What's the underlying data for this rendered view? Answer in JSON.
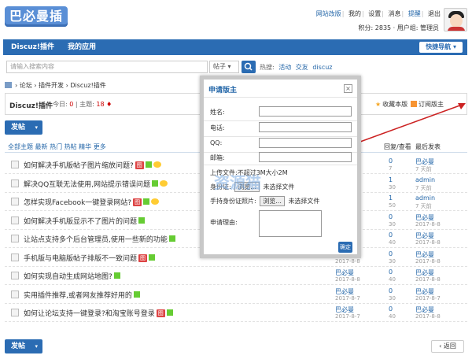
{
  "logo": {
    "text": "巴必曼插件"
  },
  "topbar": {
    "links": [
      "网站改版",
      "我的",
      "设置",
      "消息",
      "提醒",
      "退出"
    ],
    "userinfo": "积分: 2835 · 用户组: 管理员"
  },
  "nav": {
    "items": [
      "Discuz!插件",
      "我的应用"
    ],
    "quick": "快捷导航"
  },
  "search": {
    "placeholder": "请输入搜索内容",
    "type": "帖子",
    "hot_label": "热搜:",
    "hot": [
      "活动",
      "交友",
      "discuz"
    ]
  },
  "breadcrumb": [
    "论坛",
    "插件开发",
    "Discuz!插件"
  ],
  "forum": {
    "name": "Discuz!插件",
    "stats_label": "今日:",
    "today": "0",
    "topics_label": "主题:",
    "topics": "18",
    "fav": "收藏本版",
    "subscribe": "订阅版主"
  },
  "buttons": {
    "post": "发帖",
    "back": "返回"
  },
  "list": {
    "header_title": "全部主题  最新 热门 热帖 精华 更多",
    "header_author": "回复/查看",
    "header_last": "最后发表",
    "rows": [
      {
        "title": "如何解决手机版帖子图片缩放问题?",
        "badge": "图",
        "author": "巴必曼",
        "date": "2017-8-8",
        "cnt": "0",
        "cnt2": "7",
        "last": "巴必曼",
        "last2": "7 天前"
      },
      {
        "title": "解决QQ互联无法使用,网站提示错误问题",
        "badge": "",
        "author": "巴必曼",
        "date": "2017-8-8",
        "cnt": "1",
        "cnt2": "30",
        "last": "admin",
        "last2": "7 天前"
      },
      {
        "title": "怎样实现Facebook一键登录网站?",
        "badge": "图",
        "author": "巴必曼",
        "date": "2017-8-8",
        "cnt": "1",
        "cnt2": "50",
        "last": "admin",
        "last2": "7 天前"
      },
      {
        "title": "如何解决手机版显示不了图片的问题",
        "badge": "",
        "author": "巴必曼",
        "date": "2017-8-8",
        "cnt": "0",
        "cnt2": "30",
        "last": "巴必曼",
        "last2": "2017-8-8"
      },
      {
        "title": "让站点支持多个后台管理员,使用一些新的功能",
        "badge": "",
        "author": "巴必曼",
        "date": "2017-8-8",
        "cnt": "0",
        "cnt2": "40",
        "last": "巴必曼",
        "last2": "2017-8-8"
      },
      {
        "title": "手机版与电脑版帖子排版不一致问题",
        "badge": "图",
        "author": "巴必曼",
        "date": "2017-8-8",
        "cnt": "0",
        "cnt2": "30",
        "last": "巴必曼",
        "last2": "2017-8-8"
      },
      {
        "title": "如何实现自动生成网站地图?",
        "badge": "",
        "author": "巴必曼",
        "date": "2017-8-8",
        "cnt": "0",
        "cnt2": "40",
        "last": "巴必曼",
        "last2": "2017-8-8"
      },
      {
        "title": "实用插件推荐,或者网友推荐好用的",
        "badge": "",
        "author": "巴必曼",
        "date": "2017-8-7",
        "cnt": "0",
        "cnt2": "30",
        "last": "巴必曼",
        "last2": "2017-8-7"
      },
      {
        "title": "如何让论坛支持一键登录?和淘宝账号登录",
        "badge": "图",
        "author": "巴必曼",
        "date": "2017-8-7",
        "cnt": "0",
        "cnt2": "40",
        "last": "巴必曼",
        "last2": "2017-8-8"
      }
    ]
  },
  "modal": {
    "title": "申请版主",
    "fields": [
      {
        "label": "姓名:"
      },
      {
        "label": "电话:"
      },
      {
        "label": "QQ:"
      },
      {
        "label": "邮箱:"
      }
    ],
    "hint": "上传文件:不超过3M大小2M",
    "upload1_label": "身份证:",
    "upload2_label": "手持身份证照片:",
    "browse": "浏览...",
    "nofile": "未选择文件",
    "reason_label": "申请理由:",
    "submit": "确定"
  },
  "watermark": "资源猫"
}
